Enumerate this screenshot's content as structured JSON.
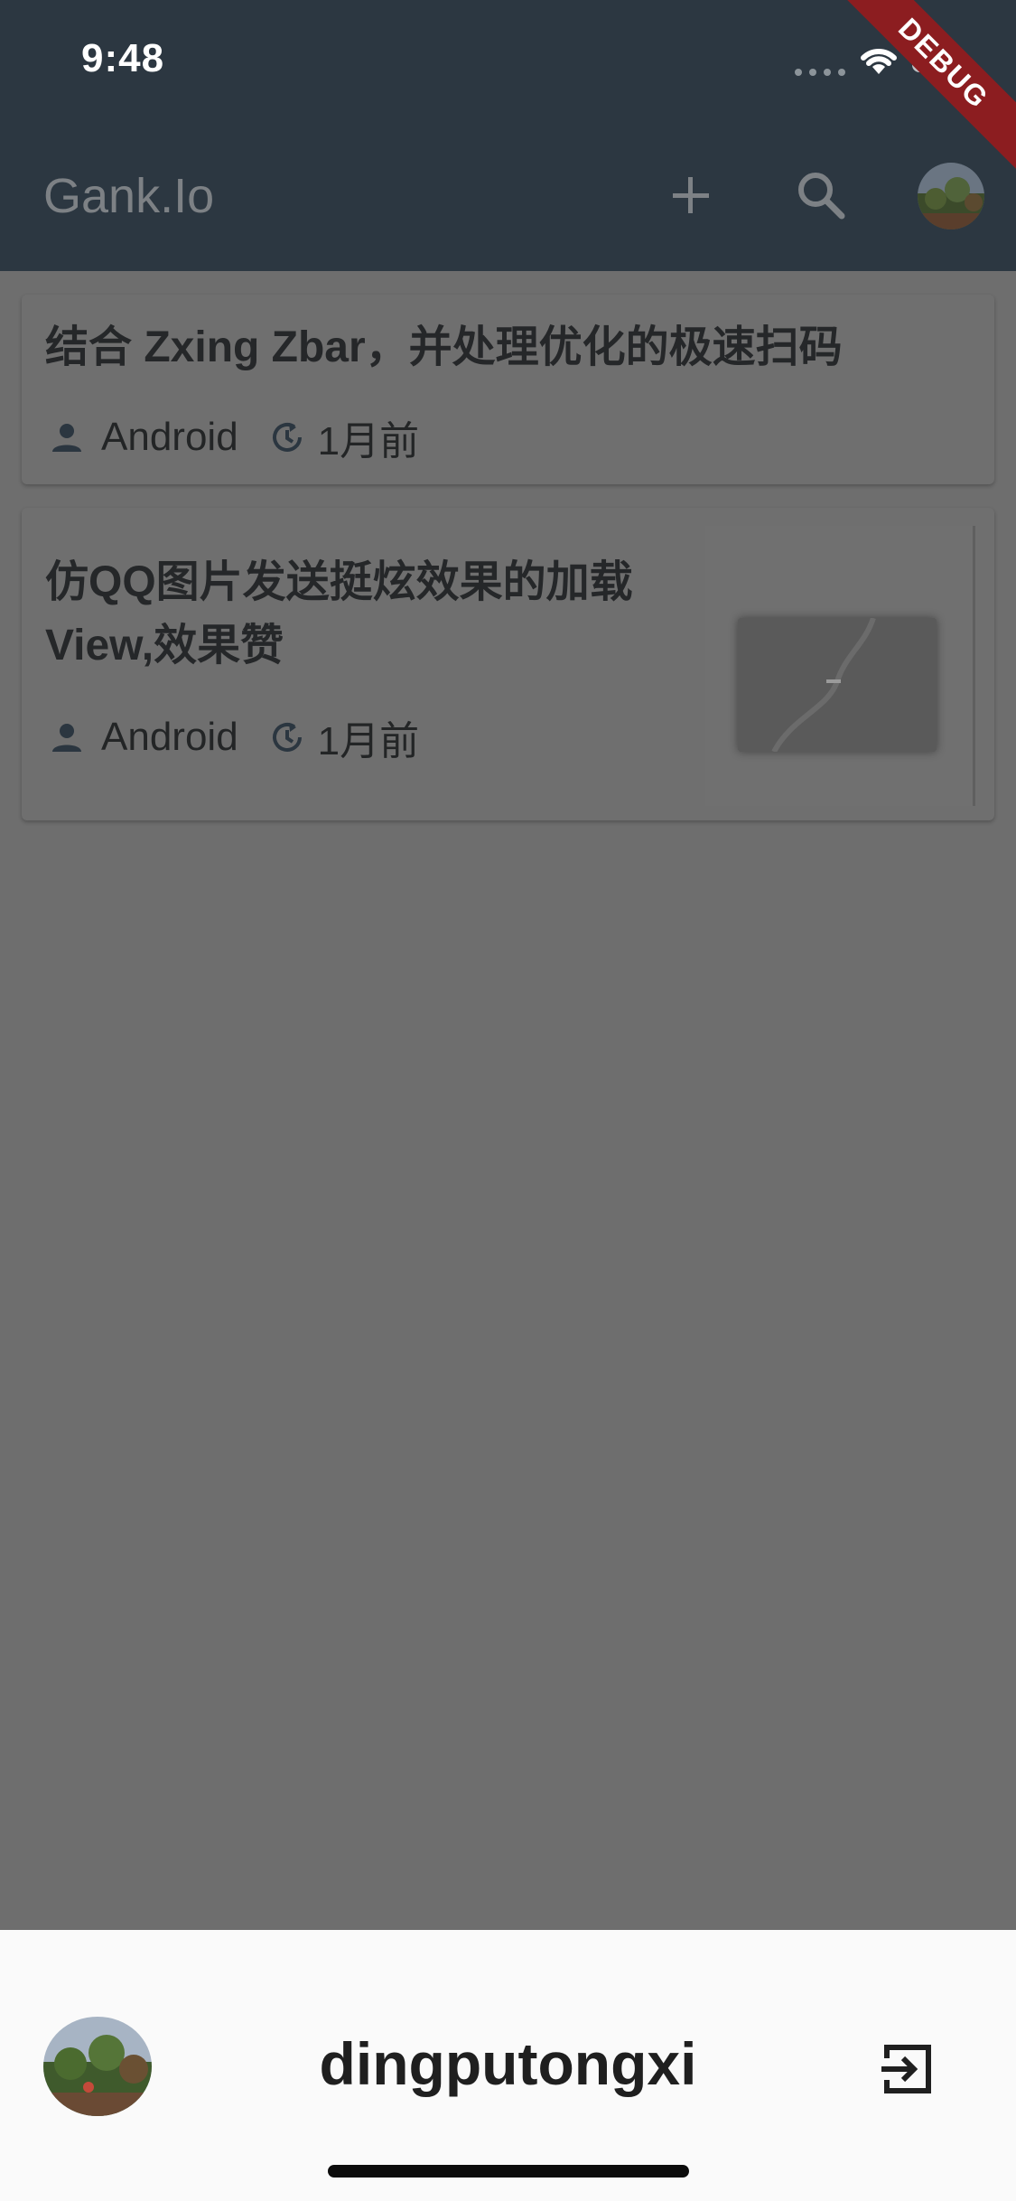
{
  "status_bar": {
    "time": "9:48",
    "debug_label": "DEBUG"
  },
  "header": {
    "title": "Gank.Io",
    "add_icon": "plus-icon",
    "search_icon": "search-icon",
    "avatar_icon": "avatar"
  },
  "articles": [
    {
      "title": "结合 Zxing Zbar，并处理优化的极速扫码",
      "author": "Android",
      "time": "1月前",
      "has_thumbnail": false
    },
    {
      "title": "仿QQ图片发送挺炫效果的加载View,效果赞",
      "author": "Android",
      "time": "1月前",
      "has_thumbnail": true
    }
  ],
  "bottom_sheet": {
    "username": "dingputongxi",
    "logout_icon": "logout-icon"
  },
  "colors": {
    "header_bg": "#2c3741",
    "overlay": "#6e6e6e",
    "sheet_bg": "#fafafa",
    "debug_ribbon": "#8c1d20"
  }
}
